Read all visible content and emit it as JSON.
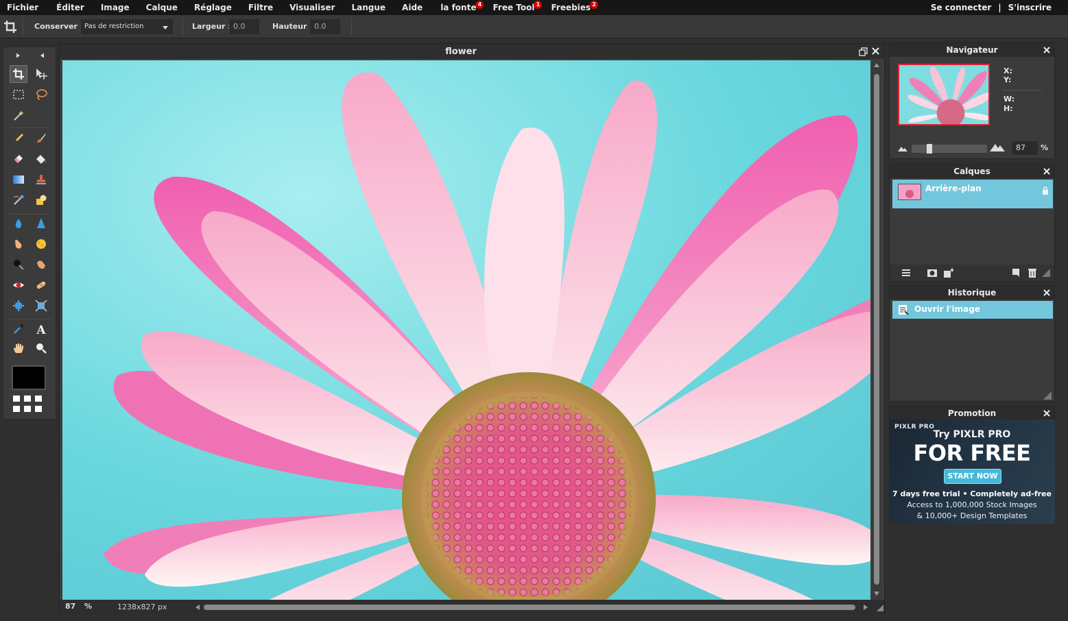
{
  "menubar": {
    "items": [
      "Fichier",
      "Éditer",
      "Image",
      "Calque",
      "Réglage",
      "Filtre",
      "Visualiser",
      "Langue",
      "Aide"
    ],
    "promo_items": [
      {
        "label": "la fonte",
        "badge": "4"
      },
      {
        "label": "Free Tool",
        "badge": "1"
      },
      {
        "label": "Freebies",
        "badge": "2"
      }
    ],
    "login": "Se connecter",
    "separator": "|",
    "signup": "S'inscrire"
  },
  "options": {
    "conserver_label": "Conserver :",
    "conserver_value": "Pas de restriction",
    "largeur_label": "Largeur :",
    "largeur_value": "0.0",
    "hauteur_label": "Hauteur :",
    "hauteur_value": "0.0"
  },
  "document": {
    "title": "flower",
    "zoom": "87",
    "zoom_unit": "%",
    "size": "1238x827 px"
  },
  "navigator": {
    "title": "Navigateur",
    "x_label": "X:",
    "y_label": "Y:",
    "w_label": "W:",
    "h_label": "H:",
    "zoom": "87",
    "zoom_unit": "%"
  },
  "layers": {
    "title": "Calques",
    "items": [
      {
        "name": "Arrière-plan"
      }
    ]
  },
  "history": {
    "title": "Historique",
    "items": [
      {
        "name": "Ouvrir l'image"
      }
    ]
  },
  "promotion": {
    "title": "Promotion",
    "brand": "PIXLR PRO",
    "line1": "Try PIXLR PRO",
    "line2": "FOR FREE",
    "cta": "START NOW",
    "line3": "7 days free trial • Completely ad-free",
    "line4": "Access to 1,000,000 Stock Images",
    "line5": "& 10,000+ Design Templates"
  },
  "colors": {
    "accent_row": "#74c6dc",
    "badge": "#d40000",
    "foreground_color": "#000000"
  }
}
